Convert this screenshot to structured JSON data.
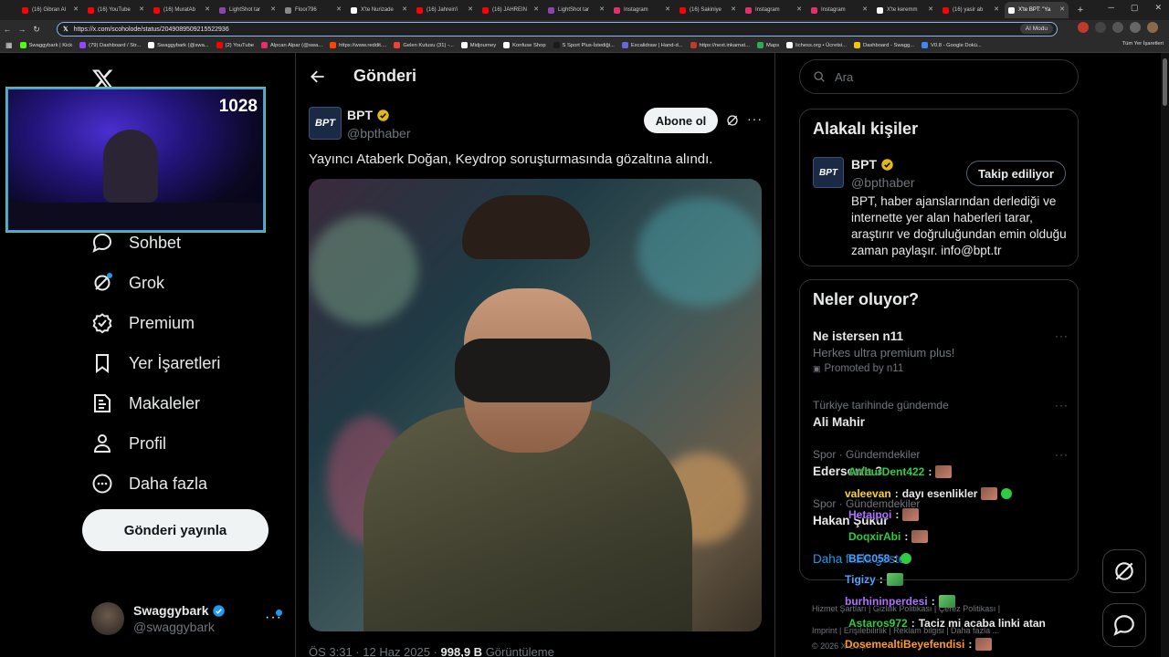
{
  "browser": {
    "tabs": [
      {
        "title": "(16) Gibran Al",
        "color": "#ff0000"
      },
      {
        "title": "(16) YouTube",
        "color": "#ff0000"
      },
      {
        "title": "(16) MuratAb",
        "color": "#ff0000"
      },
      {
        "title": "LightShot tar",
        "color": "#8e44ad"
      },
      {
        "title": "Floor796",
        "color": "#888888"
      },
      {
        "title": "X'te Nurizade",
        "color": "#ffffff"
      },
      {
        "title": "(16) Jahrein'i",
        "color": "#ff0000"
      },
      {
        "title": "(16) JAHREIN",
        "color": "#ff0000"
      },
      {
        "title": "LightShot tar",
        "color": "#8e44ad"
      },
      {
        "title": "Instagram",
        "color": "#e1306c"
      },
      {
        "title": "(16) Sakiniye",
        "color": "#ff0000"
      },
      {
        "title": "Instagram",
        "color": "#e1306c"
      },
      {
        "title": "Instagram",
        "color": "#e1306c"
      },
      {
        "title": "X'te keremm",
        "color": "#ffffff"
      },
      {
        "title": "(16) yasir ab",
        "color": "#ff0000"
      },
      {
        "title": "X'te BPT: \"Ya",
        "color": "#ffffff"
      }
    ],
    "url": "https://x.com/scoholode/status/2049089509215522936",
    "ai_mode": "AI Modu",
    "bookmarks": [
      {
        "label": "Swaggybark | Kick",
        "color": "#53fc18"
      },
      {
        "label": "(79) Dashboard / Str...",
        "color": "#9146ff"
      },
      {
        "label": "Swaggybark (@swa...",
        "color": "#ffffff"
      },
      {
        "label": "(2) YouTube",
        "color": "#ff0000"
      },
      {
        "label": "Alpcan Alpar (@swa...",
        "color": "#e1306c"
      },
      {
        "label": "https://www.reddit....",
        "color": "#ff4500"
      },
      {
        "label": "Gelen Kutusu (31) -...",
        "color": "#ea4335"
      },
      {
        "label": "Midjourney",
        "color": "#ffffff"
      },
      {
        "label": "Konfuse Shop",
        "color": "#ffffff"
      },
      {
        "label": "S Sport Plus-İstediği...",
        "color": "#1a1a1a"
      },
      {
        "label": "Excalidraw | Hand-d...",
        "color": "#6965db"
      },
      {
        "label": "https://next.inkarnat...",
        "color": "#c0392b"
      },
      {
        "label": "Maps",
        "color": "#34a853"
      },
      {
        "label": "lichess.org • Ücretsi...",
        "color": "#ffffff"
      },
      {
        "label": "Dashboard - Swagg...",
        "color": "#f1c40f"
      },
      {
        "label": "V0.8 - Google Dokü...",
        "color": "#4285f4"
      }
    ],
    "all_bookmarks": "Tüm Yer İşaretleri"
  },
  "webcam": {
    "count": "1028"
  },
  "nav": {
    "items": [
      {
        "label": "Sohbet",
        "icon": "chat-icon"
      },
      {
        "label": "Grok",
        "icon": "grok-icon"
      },
      {
        "label": "Premium",
        "icon": "premium-icon"
      },
      {
        "label": "Yer İşaretleri",
        "icon": "bookmark-icon"
      },
      {
        "label": "Makaleler",
        "icon": "article-icon"
      },
      {
        "label": "Profil",
        "icon": "profile-icon"
      },
      {
        "label": "Daha fazla",
        "icon": "more-icon"
      }
    ],
    "post_button": "Gönderi yayınla",
    "account": {
      "name": "Swaggybark",
      "handle": "@swaggybark"
    }
  },
  "main": {
    "title": "Gönderi",
    "post": {
      "author": "BPT",
      "handle": "@bpthaber",
      "avatar_text": "BPT",
      "follow": "Abone ol",
      "text": "Yayıncı Ataberk Doğan, Keydrop soruşturmasında gözaltına alındı.",
      "time": "ÖS 3:31 · 12 Haz 2025 · ",
      "views": "998,9 B",
      "views_label": " Görüntüleme"
    }
  },
  "right": {
    "search_placeholder": "Ara",
    "related": {
      "title": "Alakalı kişiler",
      "name": "BPT",
      "handle": "@bpthaber",
      "avatar_text": "BPT",
      "button": "Takip ediliyor",
      "bio": "BPT, haber ajanslarından derlediği ve internette yer alan haberleri tarar, araştırır ve doğruluğundan emin olduğu zaman paylaşır. info@bpt.tr"
    },
    "trends": {
      "title": "Neler oluyor?",
      "items": [
        {
          "context": "",
          "title": "Ne istersen n11",
          "sub": "Herkes ultra premium plus!",
          "promo": "Promoted by n11"
        },
        {
          "context": "Türkiye tarihinde gündemde",
          "title": "Ali Mahir",
          "sub": "",
          "promo": ""
        },
        {
          "context": "Spor · Gündemdekiler",
          "title": "Ederson'a 3",
          "sub": "",
          "promo": ""
        },
        {
          "context": "Spor · Gündemdekiler",
          "title": "Hakan Şükür",
          "sub": "",
          "promo": ""
        }
      ],
      "show_more": "Daha fazla göster"
    },
    "footer": {
      "line1": "Hizmet Şartları  |  Gizlilik Politikası  |  Çerez Politikası  |",
      "line2": "Imprint  |  Erişilebilirlik  |  Reklam bilgisi  |  Daha fazla ...",
      "line3": "© 2026 X Corp."
    }
  },
  "chat": [
    {
      "user": "ArthurDent422",
      "color": "#2ecc40",
      "msg": "",
      "emote": "face"
    },
    {
      "user": "valeevan",
      "color": "#ffd700",
      "msg": "dayı esenlikler",
      "emote": "face",
      "extra": "pepe"
    },
    {
      "user": "Hetaipoi",
      "color": "#b070ff",
      "msg": "",
      "emote": "face"
    },
    {
      "user": "DoqxirAbi",
      "color": "#2ecc40",
      "msg": "",
      "emote": "face"
    },
    {
      "user": "BEC058",
      "color": "#4fa3ff",
      "msg": "",
      "emote": "pepe"
    },
    {
      "user": "Tigizy",
      "color": "#4fa3ff",
      "msg": "",
      "emote": "green"
    },
    {
      "user": "burhininperdesi",
      "color": "#b070ff",
      "msg": "",
      "emote": "green"
    },
    {
      "user": "Astaros972",
      "color": "#2ecc40",
      "msg": "Taciz mi acaba linki atan",
      "emote": ""
    },
    {
      "user": "DosemealtiBeyefendisi",
      "color": "#ff9a2e",
      "msg": "",
      "emote": "face"
    }
  ]
}
